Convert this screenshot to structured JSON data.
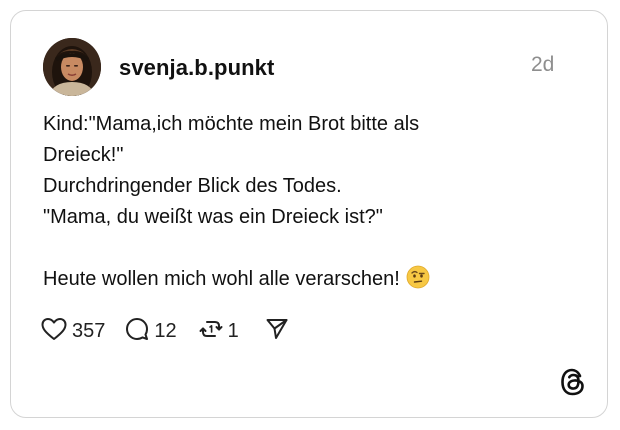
{
  "post": {
    "username": "svenja.b.punkt",
    "timestamp": "2d",
    "text_lines": [
      "Kind:\"Mama,ich möchte mein Brot bitte als",
      "Dreieck!\"",
      "Durchdringender Blick des Todes.",
      "\"Mama, du weißt was ein Dreieck ist?\"",
      "",
      "Heute wollen mich wohl alle verarschen!"
    ],
    "emoji": "face-with-raised-eyebrow"
  },
  "actions": {
    "likes": "357",
    "replies": "12",
    "reposts": "1"
  },
  "icons": {
    "like": "heart-icon",
    "reply": "comment-icon",
    "repost": "repost-icon",
    "share": "send-icon",
    "brand": "threads-logo"
  }
}
